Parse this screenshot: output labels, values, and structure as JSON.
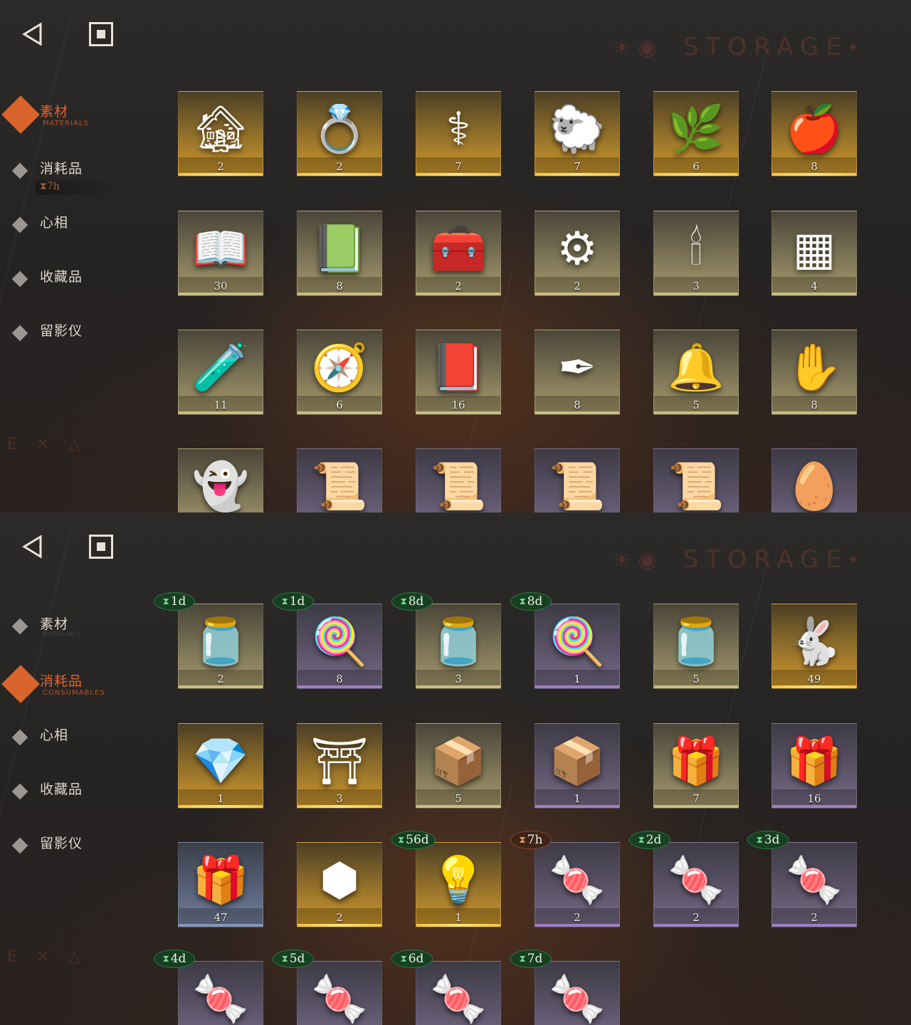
{
  "storage_title": "STORAGE",
  "screens": [
    {
      "id": "materials",
      "tabs": [
        {
          "label": "素材",
          "sub": "MATERIALS",
          "active": true,
          "icon": "diamond-icon"
        },
        {
          "label": "消耗品",
          "sub": "",
          "active": false,
          "icon": "diamond-icon",
          "timer": "7h"
        },
        {
          "label": "心相",
          "sub": "",
          "active": false,
          "icon": "diamond-icon"
        },
        {
          "label": "收藏品",
          "sub": "",
          "active": false,
          "icon": "diamond-icon"
        },
        {
          "label": "留影仪",
          "sub": "",
          "active": false,
          "icon": "diamond-icon"
        }
      ],
      "rows": [
        [
          {
            "icon": "hut-on-legs-icon",
            "glyph": "🏚",
            "count": "2",
            "rarity": "gold"
          },
          {
            "icon": "golden-ring-icon",
            "glyph": "💍",
            "count": "2",
            "rarity": "gold"
          },
          {
            "icon": "caduceus-icon",
            "glyph": "⚕",
            "count": "7",
            "rarity": "gold"
          },
          {
            "icon": "golden-sheep-icon",
            "glyph": "🐑",
            "count": "7",
            "rarity": "gold"
          },
          {
            "icon": "laurel-wreath-icon",
            "glyph": "🌿",
            "count": "6",
            "rarity": "gold"
          },
          {
            "icon": "apple-serpent-icon",
            "glyph": "🍎",
            "count": "8",
            "rarity": "gold"
          }
        ],
        [
          {
            "icon": "red-gem-book-icon",
            "glyph": "📖",
            "count": "30",
            "rarity": "tan"
          },
          {
            "icon": "green-gem-book-icon",
            "glyph": "📗",
            "count": "8",
            "rarity": "tan"
          },
          {
            "icon": "rooted-chest-icon",
            "glyph": "🧰",
            "count": "2",
            "rarity": "tan"
          },
          {
            "icon": "astrolabe-icon",
            "glyph": "⚙",
            "count": "2",
            "rarity": "tan"
          },
          {
            "icon": "ouija-board-icon",
            "glyph": "🕯",
            "count": "3",
            "rarity": "tan"
          },
          {
            "icon": "green-tablet-icon",
            "glyph": "▦",
            "count": "4",
            "rarity": "tan"
          }
        ],
        [
          {
            "icon": "potion-bottle-icon",
            "glyph": "🧪",
            "count": "11",
            "rarity": "tan"
          },
          {
            "icon": "compass-disc-icon",
            "glyph": "🧭",
            "count": "6",
            "rarity": "tan"
          },
          {
            "icon": "dark-tome-icon",
            "glyph": "📕",
            "count": "16",
            "rarity": "tan"
          },
          {
            "icon": "pen-nibs-icon",
            "glyph": "✒",
            "count": "8",
            "rarity": "tan"
          },
          {
            "icon": "bell-jar-icon",
            "glyph": "🔔",
            "count": "5",
            "rarity": "tan"
          },
          {
            "icon": "hand-box-icon",
            "glyph": "✋",
            "count": "8",
            "rarity": "tan"
          }
        ],
        [
          {
            "icon": "ghost-icon",
            "glyph": "👻",
            "count": "",
            "rarity": "tan"
          },
          {
            "icon": "scroll-red-icon",
            "glyph": "📜",
            "count": "",
            "rarity": "purple"
          },
          {
            "icon": "scroll-green-icon",
            "glyph": "📜",
            "count": "",
            "rarity": "purple"
          },
          {
            "icon": "scroll-blue-icon",
            "glyph": "📜",
            "count": "",
            "rarity": "purple"
          },
          {
            "icon": "scroll-gold-icon",
            "glyph": "📜",
            "count": "",
            "rarity": "purple"
          },
          {
            "icon": "ornate-egg-icon",
            "glyph": "🥚",
            "count": "",
            "rarity": "purple"
          }
        ]
      ]
    },
    {
      "id": "consumables",
      "tabs": [
        {
          "label": "素材",
          "sub": "MATERIALS",
          "active": false,
          "icon": "diamond-icon"
        },
        {
          "label": "消耗品",
          "sub": "CONSUMABLES",
          "active": true,
          "icon": "diamond-icon"
        },
        {
          "label": "心相",
          "sub": "",
          "active": false,
          "icon": "diamond-icon"
        },
        {
          "label": "收藏品",
          "sub": "",
          "active": false,
          "icon": "diamond-icon"
        },
        {
          "label": "留影仪",
          "sub": "",
          "active": false,
          "icon": "diamond-icon"
        }
      ],
      "rows": [
        [
          {
            "icon": "candy-jar-icon",
            "glyph": "🫙",
            "count": "2",
            "rarity": "tan",
            "badge": "1d",
            "badge_color": "green"
          },
          {
            "icon": "lollipops-icon",
            "glyph": "🍭",
            "count": "8",
            "rarity": "purple",
            "badge": "1d",
            "badge_color": "green"
          },
          {
            "icon": "candy-jar-icon",
            "glyph": "🫙",
            "count": "3",
            "rarity": "tan",
            "badge": "8d",
            "badge_color": "green"
          },
          {
            "icon": "lollipops-icon",
            "glyph": "🍭",
            "count": "1",
            "rarity": "purple",
            "badge": "8d",
            "badge_color": "green"
          },
          {
            "icon": "candy-jar-icon",
            "glyph": "🫙",
            "count": "5",
            "rarity": "tan"
          },
          {
            "icon": "golden-rabbit-box-icon",
            "glyph": "🐇",
            "count": "49",
            "rarity": "gold"
          }
        ],
        [
          {
            "icon": "crystal-flame-icon",
            "glyph": "💎",
            "count": "1",
            "rarity": "gold"
          },
          {
            "icon": "rune-table-icon",
            "glyph": "⛩",
            "count": "3",
            "rarity": "gold"
          },
          {
            "icon": "crate-icon",
            "glyph": "📦",
            "count": "5",
            "rarity": "tan"
          },
          {
            "icon": "crate-icon",
            "glyph": "📦",
            "count": "1",
            "rarity": "purple"
          },
          {
            "icon": "parcel-icon",
            "glyph": "🎁",
            "count": "7",
            "rarity": "tan"
          },
          {
            "icon": "parcel-icon",
            "glyph": "🎁",
            "count": "16",
            "rarity": "purple"
          }
        ],
        [
          {
            "icon": "parcel-icon",
            "glyph": "🎁",
            "count": "47",
            "rarity": "blue"
          },
          {
            "icon": "hexagon-puzzle-icon",
            "glyph": "⬢",
            "count": "2",
            "rarity": "gold"
          },
          {
            "icon": "brain-bulb-icon",
            "glyph": "💡",
            "count": "1",
            "rarity": "gold",
            "badge": "56d",
            "badge_color": "green"
          },
          {
            "icon": "wrapped-candy-icon",
            "glyph": "🍬",
            "count": "2",
            "rarity": "purple",
            "badge": "7h",
            "badge_color": "orange"
          },
          {
            "icon": "wrapped-candy-icon",
            "glyph": "🍬",
            "count": "2",
            "rarity": "purple",
            "badge": "2d",
            "badge_color": "green"
          },
          {
            "icon": "wrapped-candy-icon",
            "glyph": "🍬",
            "count": "2",
            "rarity": "purple",
            "badge": "3d",
            "badge_color": "green"
          }
        ],
        [
          {
            "icon": "wrapped-candy-icon",
            "glyph": "🍬",
            "count": "",
            "rarity": "purple",
            "badge": "4d",
            "badge_color": "green"
          },
          {
            "icon": "wrapped-candy-icon",
            "glyph": "🍬",
            "count": "",
            "rarity": "purple",
            "badge": "5d",
            "badge_color": "green"
          },
          {
            "icon": "wrapped-candy-icon",
            "glyph": "🍬",
            "count": "",
            "rarity": "purple",
            "badge": "6d",
            "badge_color": "green"
          },
          {
            "icon": "wrapped-candy-icon",
            "glyph": "🍬",
            "count": "",
            "rarity": "purple",
            "badge": "7d",
            "badge_color": "green"
          }
        ]
      ]
    }
  ]
}
